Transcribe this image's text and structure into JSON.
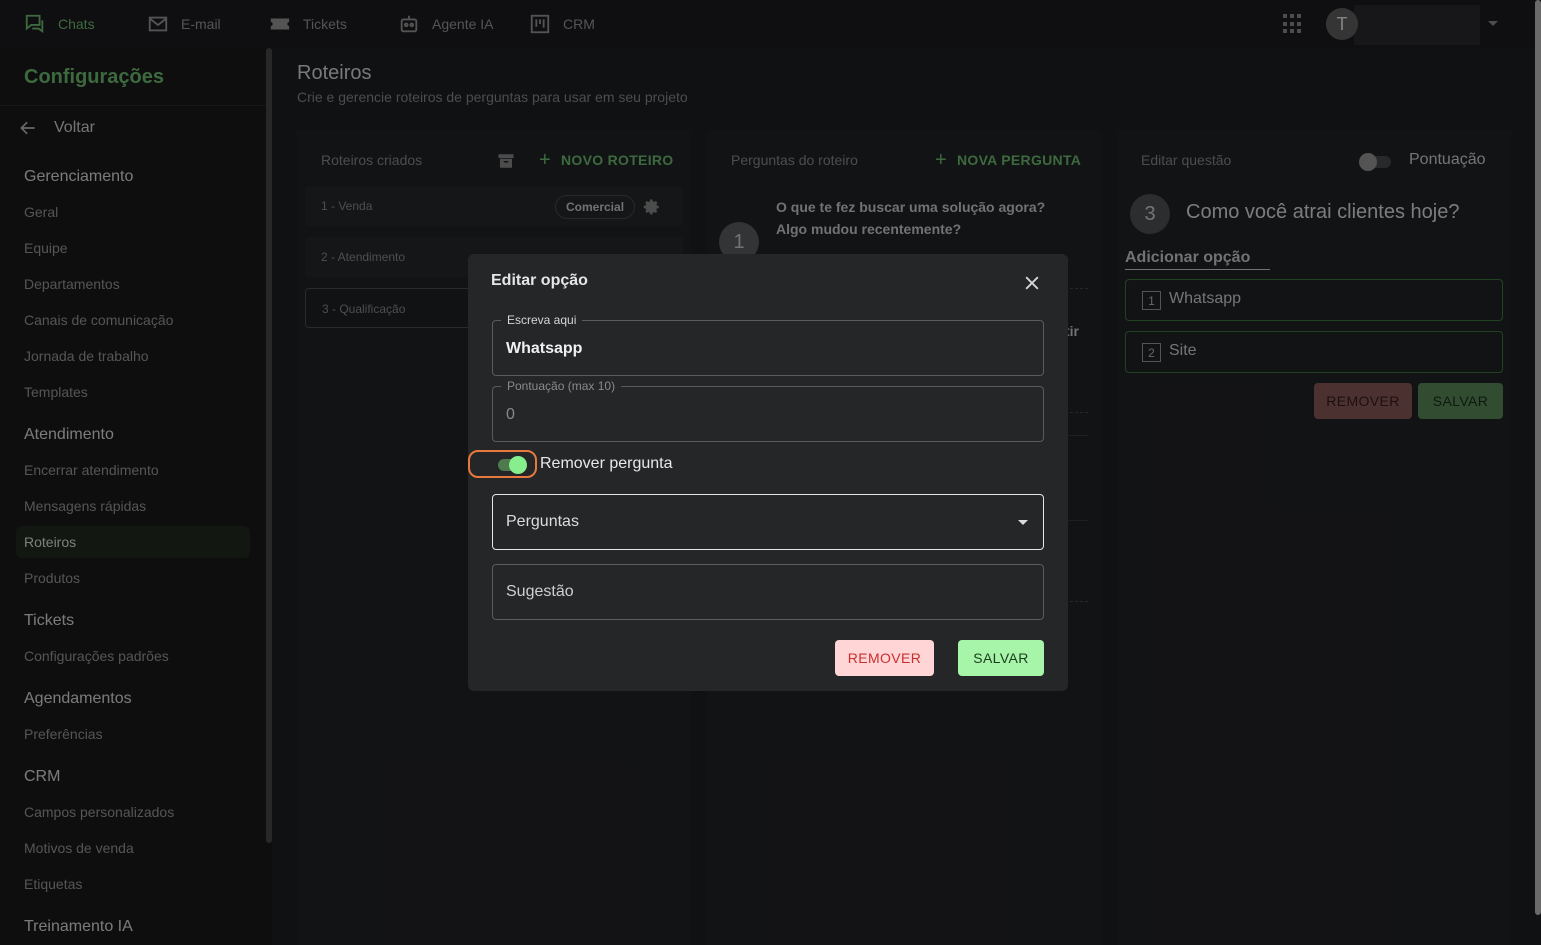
{
  "topnav": {
    "items": [
      {
        "label": "Chats",
        "icon": "chat-icon",
        "active": true
      },
      {
        "label": "E-mail",
        "icon": "mail-icon"
      },
      {
        "label": "Tickets",
        "icon": "ticket-icon"
      },
      {
        "label": "Agente IA",
        "icon": "robot-icon"
      },
      {
        "label": "CRM",
        "icon": "kanban-icon"
      }
    ],
    "avatar_initial": "T"
  },
  "sidebar": {
    "title": "Configurações",
    "back_label": "Voltar",
    "sections": [
      {
        "title": "Gerenciamento",
        "items": [
          "Geral",
          "Equipe",
          "Departamentos",
          "Canais de comunicação",
          "Jornada de trabalho",
          "Templates"
        ]
      },
      {
        "title": "Atendimento",
        "items": [
          "Encerrar atendimento",
          "Mensagens rápidas",
          "Roteiros",
          "Produtos"
        ]
      },
      {
        "title": "Tickets",
        "items": [
          "Configurações padrões"
        ]
      },
      {
        "title": "Agendamentos",
        "items": [
          "Preferências"
        ]
      },
      {
        "title": "CRM",
        "items": [
          "Campos personalizados",
          "Motivos de venda",
          "Etiquetas"
        ]
      },
      {
        "title": "Treinamento IA",
        "items": []
      }
    ],
    "selected_item": "Roteiros"
  },
  "page": {
    "title": "Roteiros",
    "subtitle": "Crie e gerencie roteiros de perguntas para usar em seu projeto"
  },
  "roteiros_panel": {
    "header": "Roteiros criados",
    "new_button": "NOVO ROTEIRO",
    "items": [
      {
        "label": "1 - Venda",
        "chip": "Comercial"
      },
      {
        "label": "2 - Atendimento"
      },
      {
        "label": "3 - Qualificação"
      }
    ]
  },
  "perguntas_panel": {
    "header": "Perguntas do roteiro",
    "new_button": "NOVA PERGUNTA",
    "questions": [
      {
        "number": "1",
        "text": "O que te fez buscar uma solução agora? Algo mudou recentemente?"
      }
    ],
    "partial_text": "tir"
  },
  "editar_panel": {
    "header": "Editar questão",
    "pontuacao_label": "Pontuação",
    "pontuacao_enabled": false,
    "question_number": "3",
    "question_text": "Como você atrai clientes hoje?",
    "add_option_label": "Adicionar opção",
    "options": [
      {
        "number": "1",
        "label": "Whatsapp"
      },
      {
        "number": "2",
        "label": "Site"
      }
    ],
    "remove_button": "REMOVER",
    "save_button": "SALVAR"
  },
  "modal": {
    "title": "Editar opção",
    "text_field": {
      "label": "Escreva aqui",
      "value": "Whatsapp"
    },
    "score_field": {
      "label": "Pontuação (max 10)",
      "value": "0"
    },
    "remove_question_toggle": {
      "label": "Remover pergunta",
      "checked": true
    },
    "perguntas_select": {
      "value": "Perguntas"
    },
    "sugestao_field": {
      "placeholder": "Sugestão"
    },
    "remove_button": "REMOVER",
    "save_button": "SALVAR"
  },
  "colors": {
    "accent": "#6fbf73",
    "focus_outline": "#e9783e",
    "remove_bg": "#ffd5d5",
    "save_bg": "#a6f5a8"
  }
}
